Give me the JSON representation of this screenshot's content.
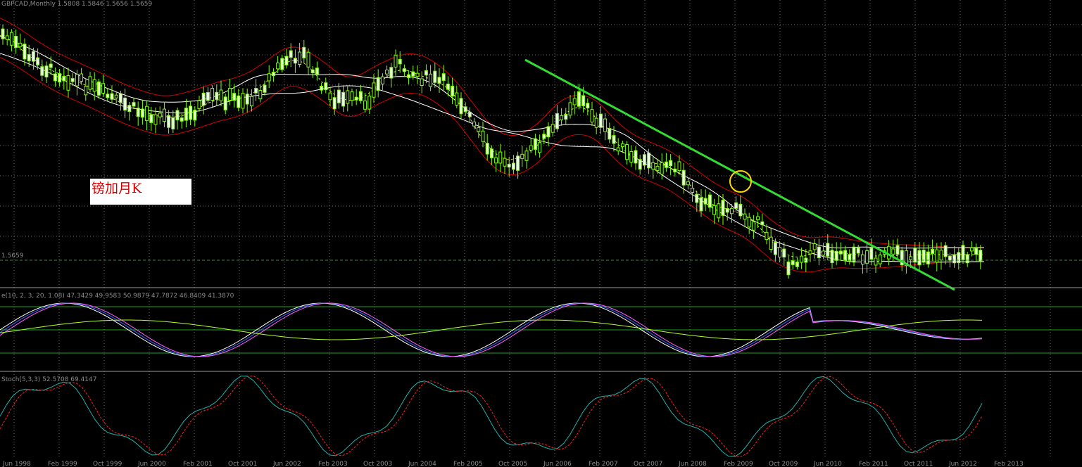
{
  "chart": {
    "symbol_header": "GBPCAD,Monthly  1.5808 1.5846 1.5656 1.5659",
    "annotation": "镑加月K",
    "price_line_label": "1.5659",
    "osc1_header": "e(10, 2, 3, 20, 1.08) 47.3429 49.9583 50.9879 47.7872 46.8409 41.3870",
    "osc2_header": "Stoch(5,3,3) 52.5708 69.4147",
    "time_labels": [
      "Jun 1998",
      "Feb 1999",
      "Oct 1999",
      "Jun 2000",
      "Feb 2001",
      "Oct 2001",
      "Jun 2002",
      "Feb 2003",
      "Oct 2003",
      "Jun 2004",
      "Feb 2005",
      "Oct 2005",
      "Jun 2006",
      "Feb 2007",
      "Oct 2007",
      "Jun 2008",
      "Feb 2009",
      "Oct 2009",
      "Jun 2010",
      "Feb 2011",
      "Oct 2011",
      "Jun 2012",
      "Feb 2013"
    ],
    "colors": {
      "background": "#000000",
      "grid": "#6b6b6b",
      "candle": "#7fff00",
      "bollinger": "#d40000",
      "ma": "#ffffff",
      "trendline": "#32dc32",
      "circle": "#ffd800",
      "stoch_main": "#20b2aa",
      "stoch_signal": "#ff2020"
    }
  },
  "chart_data": {
    "type": "candlestick",
    "title": "GBPCAD,Monthly",
    "ohlc_last": {
      "open": 1.5808,
      "high": 1.5846,
      "low": 1.5656,
      "close": 1.5659
    },
    "trendline": {
      "from": "Jul 2006",
      "to": "Feb 2013"
    },
    "highlight": "Feb 2009",
    "stochastic": {
      "params": "5,3,3",
      "main": 52.5708,
      "signal": 69.4147
    }
  }
}
